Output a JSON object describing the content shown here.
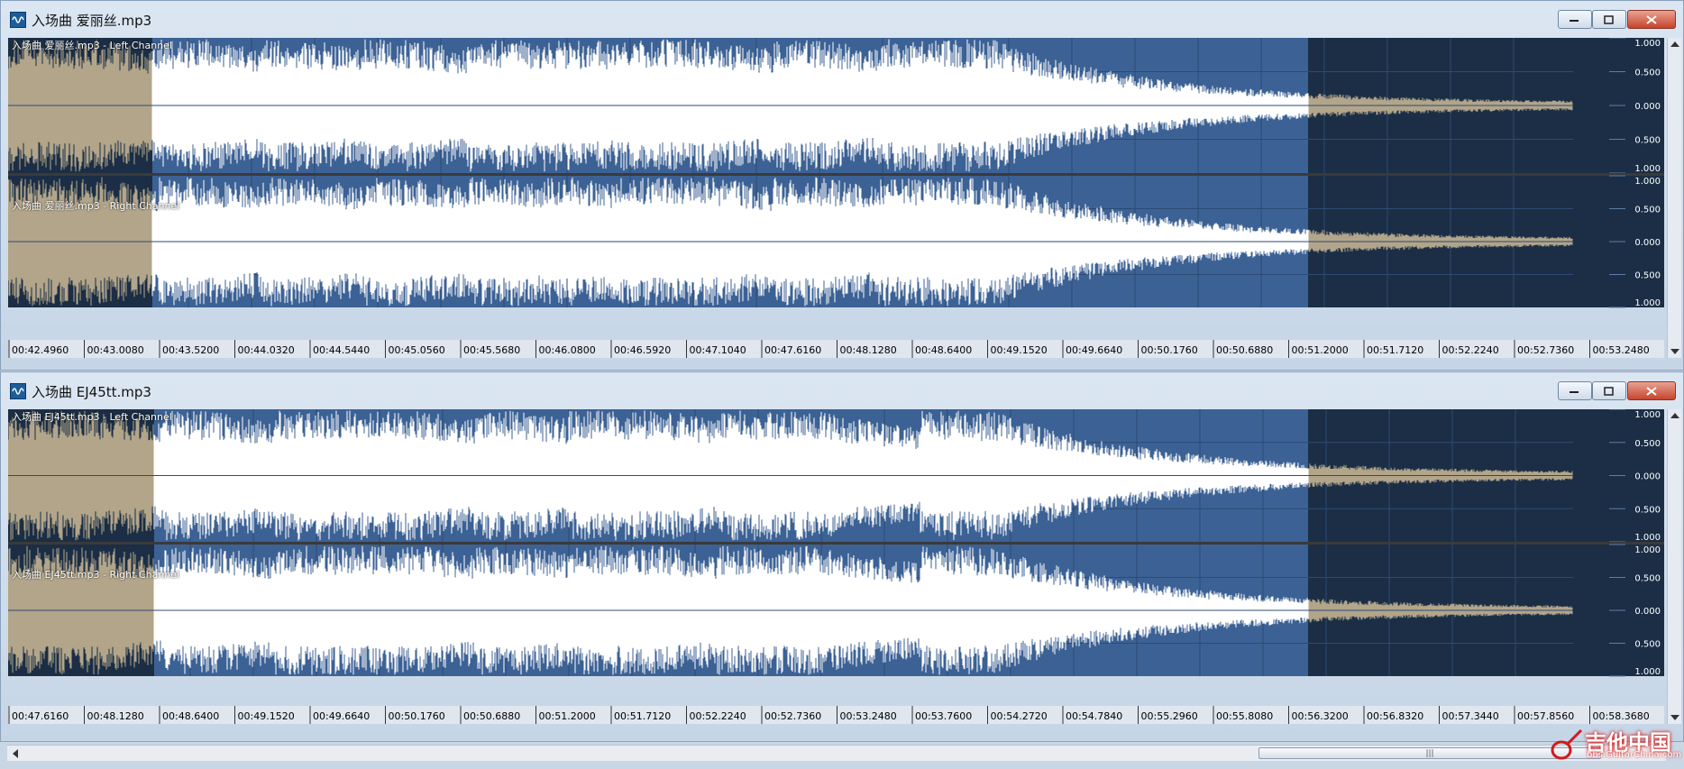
{
  "colors": {
    "wave_bg": "#3c6295",
    "wave_bg_dim": "#1b2e45",
    "wave_fg": "#ffffff",
    "wave_fg_dim": "#b2a58a",
    "grid": "#2c4b75",
    "separator": "#3a3a3a",
    "time_bar": "#dfe6ee"
  },
  "windows": [
    {
      "title": "入场曲 爱丽丝.mp3",
      "channels": [
        "入场曲 爱丽丝.mp3 - Left Channel",
        "入场曲 爱丽丝.mp3 - Right Channel"
      ],
      "time_ticks": [
        "00:42.4960",
        "00:43.0080",
        "00:43.5200",
        "00:44.0320",
        "00:44.5440",
        "00:45.0560",
        "00:45.5680",
        "00:46.0800",
        "00:46.5920",
        "00:47.1040",
        "00:47.6160",
        "00:48.1280",
        "00:48.6400",
        "00:49.1520",
        "00:49.6640",
        "00:50.1760",
        "00:50.6880",
        "00:51.2000",
        "00:51.7120",
        "00:52.2240",
        "00:52.7360",
        "00:53.2480"
      ]
    },
    {
      "title": "入场曲 EJ45tt.mp3",
      "channels": [
        "入场曲 EJ45tt.mp3 - Left Channel",
        "入场曲 EJ45tt.mp3 - Right Channel"
      ],
      "time_ticks": [
        "00:47.6160",
        "00:48.1280",
        "00:48.6400",
        "00:49.1520",
        "00:49.6640",
        "00:50.1760",
        "00:50.6880",
        "00:51.2000",
        "00:51.7120",
        "00:52.2240",
        "00:52.7360",
        "00:53.2480",
        "00:53.7600",
        "00:54.2720",
        "00:54.7840",
        "00:55.2960",
        "00:55.8080",
        "00:56.3200",
        "00:56.8320",
        "00:57.3440",
        "00:57.8560",
        "00:58.3680"
      ]
    }
  ],
  "amplitude_scale": [
    "1.000",
    "0.500",
    "0.000",
    "0.500",
    "1.000"
  ],
  "watermark": {
    "text": "吉他中国",
    "sub": "bbs.GuitarChina.com"
  },
  "hscroll": {
    "thumb_grip": "|||"
  }
}
